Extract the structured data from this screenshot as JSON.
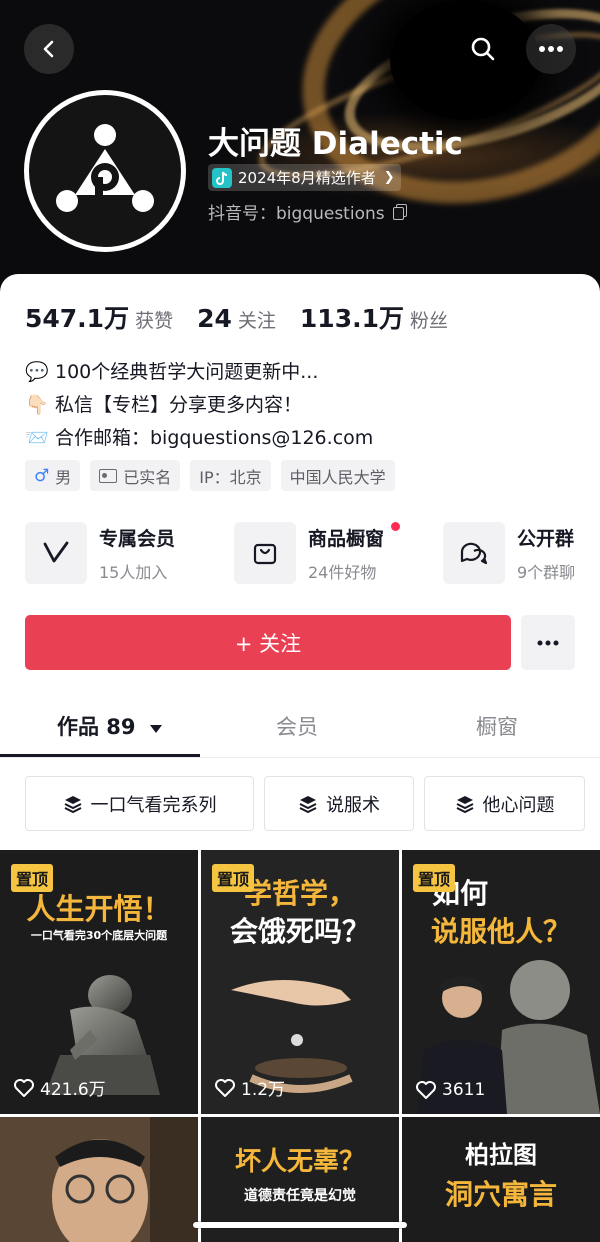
{
  "header": {
    "name": "大问题 Dialectic",
    "badge_label": "2024年8月精选作者",
    "douyin_id": "抖音号：bigquestions",
    "icons": {
      "back": "back-arrow-icon",
      "search": "search-icon",
      "more": "more-dots-icon"
    }
  },
  "stats": [
    {
      "value": "547.1万",
      "label": "获赞"
    },
    {
      "value": "24",
      "label": "关注"
    },
    {
      "value": "113.1万",
      "label": "粉丝"
    }
  ],
  "bio": [
    {
      "emoji": "💬",
      "text": "100个经典哲学大问题更新中..."
    },
    {
      "emoji": "👇🏻",
      "text": "私信【专栏】分享更多内容！"
    },
    {
      "emoji": "📨",
      "text": "合作邮箱：bigquestions@126.com"
    }
  ],
  "tags": [
    "男",
    "已实名",
    "IP：北京",
    "中国人民大学"
  ],
  "features": [
    {
      "title": "专属会员",
      "sub": "15人加入",
      "icon": "member-v-icon"
    },
    {
      "title": "商品橱窗",
      "sub": "24件好物",
      "icon": "shopping-bag-icon"
    },
    {
      "title": "公开群",
      "sub": "9个群聊",
      "icon": "group-chat-icon"
    }
  ],
  "follow_label": "+ 关注",
  "tabs": {
    "works": "作品 89",
    "members": "会员",
    "shop": "橱窗"
  },
  "series": [
    "一口气看完系列",
    "说服术",
    "他心问题"
  ],
  "videos": [
    {
      "pinned": "置顶",
      "title": "人生开悟！",
      "subtitle": "一口气看完30个底层大问题",
      "likes": "421.6万"
    },
    {
      "pinned": "置顶",
      "title": "学哲学，",
      "title2": "会饿死吗？",
      "likes": "1.2万"
    },
    {
      "pinned": "置顶",
      "title": "如何",
      "title2": "说服他人？",
      "likes": "3611"
    },
    {
      "title": ""
    },
    {
      "title": "坏人无辜？",
      "subtitle": "道德责任竟是幻觉"
    },
    {
      "title": "柏拉图",
      "title2": "洞穴寓言"
    }
  ],
  "colors": {
    "accent": "#ea4054",
    "pin": "#f5c542",
    "title_yellow": "#f5b73b"
  }
}
